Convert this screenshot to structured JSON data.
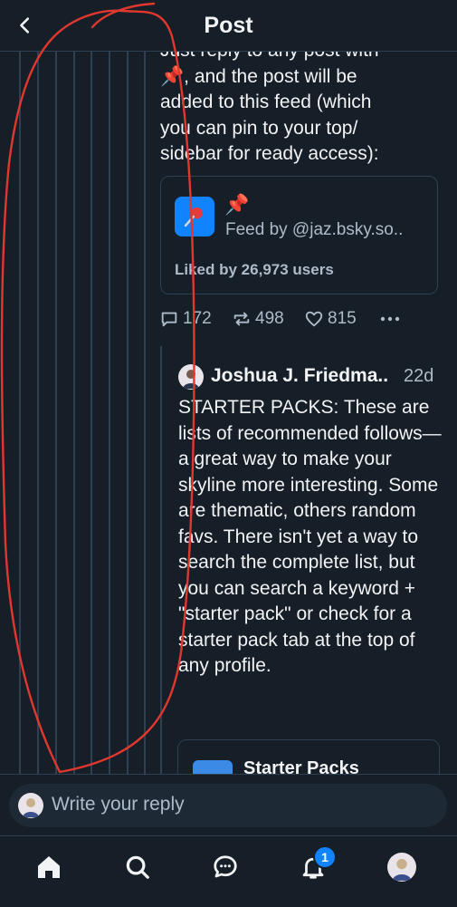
{
  "header": {
    "title": "Post",
    "back_icon": "chevron-left-icon"
  },
  "post": {
    "text": "Just reply to any post with\n📌, and the post will be\nadded to this feed (which\nyou can pin to your top/\nsidebar for ready access):",
    "feed_card": {
      "emoji": "📌",
      "by": "Feed by @jaz.bsky.so..",
      "likes": "Liked by 26,973 users"
    },
    "actions": {
      "replies": "172",
      "reposts": "498",
      "likes": "815"
    }
  },
  "reply": {
    "author": "Joshua J. Friedma..",
    "time": "22d",
    "text": "STARTER PACKS: These are lists of recommended follows—a great way to make your skyline more interesting. Some are thematic, others random favs. There isn't yet a way to search the complete list, but you can search a keyword + \"starter pack\" or check for a starter pack tab at the top of any profile.",
    "card_title": "Starter Packs"
  },
  "composer": {
    "placeholder": "Write your reply"
  },
  "tabbar": {
    "notifications_badge": "1"
  },
  "colors": {
    "background": "#161e27",
    "accent": "#1083fe",
    "annotation": "#e0372e"
  }
}
